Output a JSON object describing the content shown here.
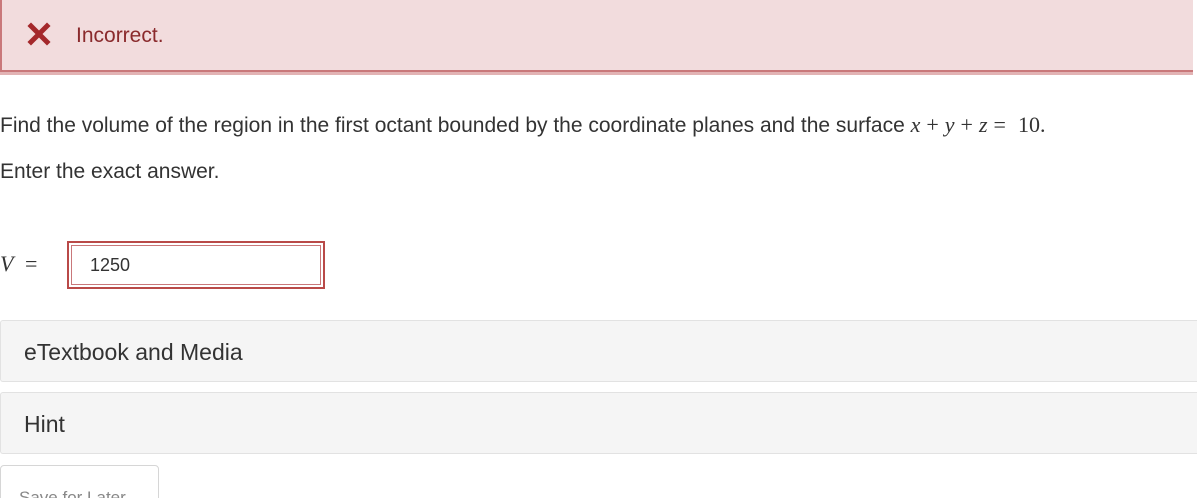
{
  "feedback": {
    "icon": "close-x-icon",
    "text": "Incorrect.",
    "accent_color": "#a4282b",
    "background_color": "#f2dcdd"
  },
  "question": {
    "prefix": "Find the volume of the region in the first octant bounded by the coordinate planes and the surface ",
    "equation": {
      "x": "x",
      "plus1": "+",
      "y": "y",
      "plus2": "+",
      "z": "z",
      "equals": "=",
      "value": "10."
    },
    "instruction": "Enter the exact answer."
  },
  "answer": {
    "variable": "V",
    "equals": "=",
    "value": "1250"
  },
  "panels": {
    "etextbook_label": "eTextbook and Media",
    "hint_label": "Hint"
  },
  "actions": {
    "save_label": "Save for Later"
  }
}
